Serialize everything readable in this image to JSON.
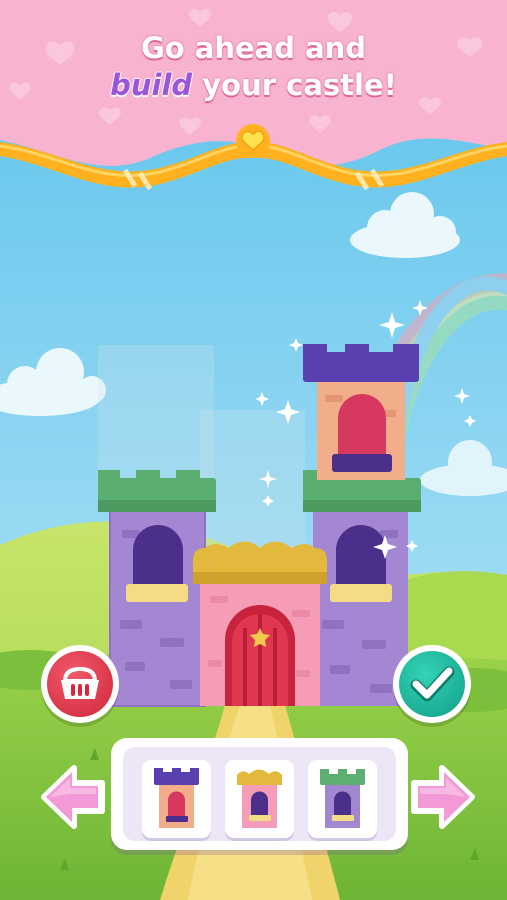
{
  "banner": {
    "line1": "Go ahead and",
    "line2_highlight": "build",
    "line2_rest": " your castle!"
  },
  "controls": {
    "delete_icon": "basket-icon",
    "confirm_icon": "checkmark-icon",
    "prev_icon": "arrow-left-icon",
    "next_icon": "arrow-right-icon"
  },
  "tray": {
    "pieces": [
      {
        "name": "purple-roof-tower-piece",
        "roof_color": "#5a3fb0",
        "wall_color": "#f2ad8a"
      },
      {
        "name": "gold-roof-tower-piece",
        "roof_color": "#e2b93d",
        "wall_color": "#f59db6"
      },
      {
        "name": "green-roof-tower-piece",
        "roof_color": "#5cae72",
        "wall_color": "#a186d0"
      }
    ]
  },
  "colors": {
    "banner_pink": "#f7b3cf",
    "ribbon_orange": "#ffb11f",
    "sky": "#7fd0f0",
    "grass": "#8ccc3c",
    "path": "#f1d36b",
    "delete_red": "#d9283e",
    "confirm_teal": "#16b096",
    "arrow_pink": "#f39ad6"
  }
}
